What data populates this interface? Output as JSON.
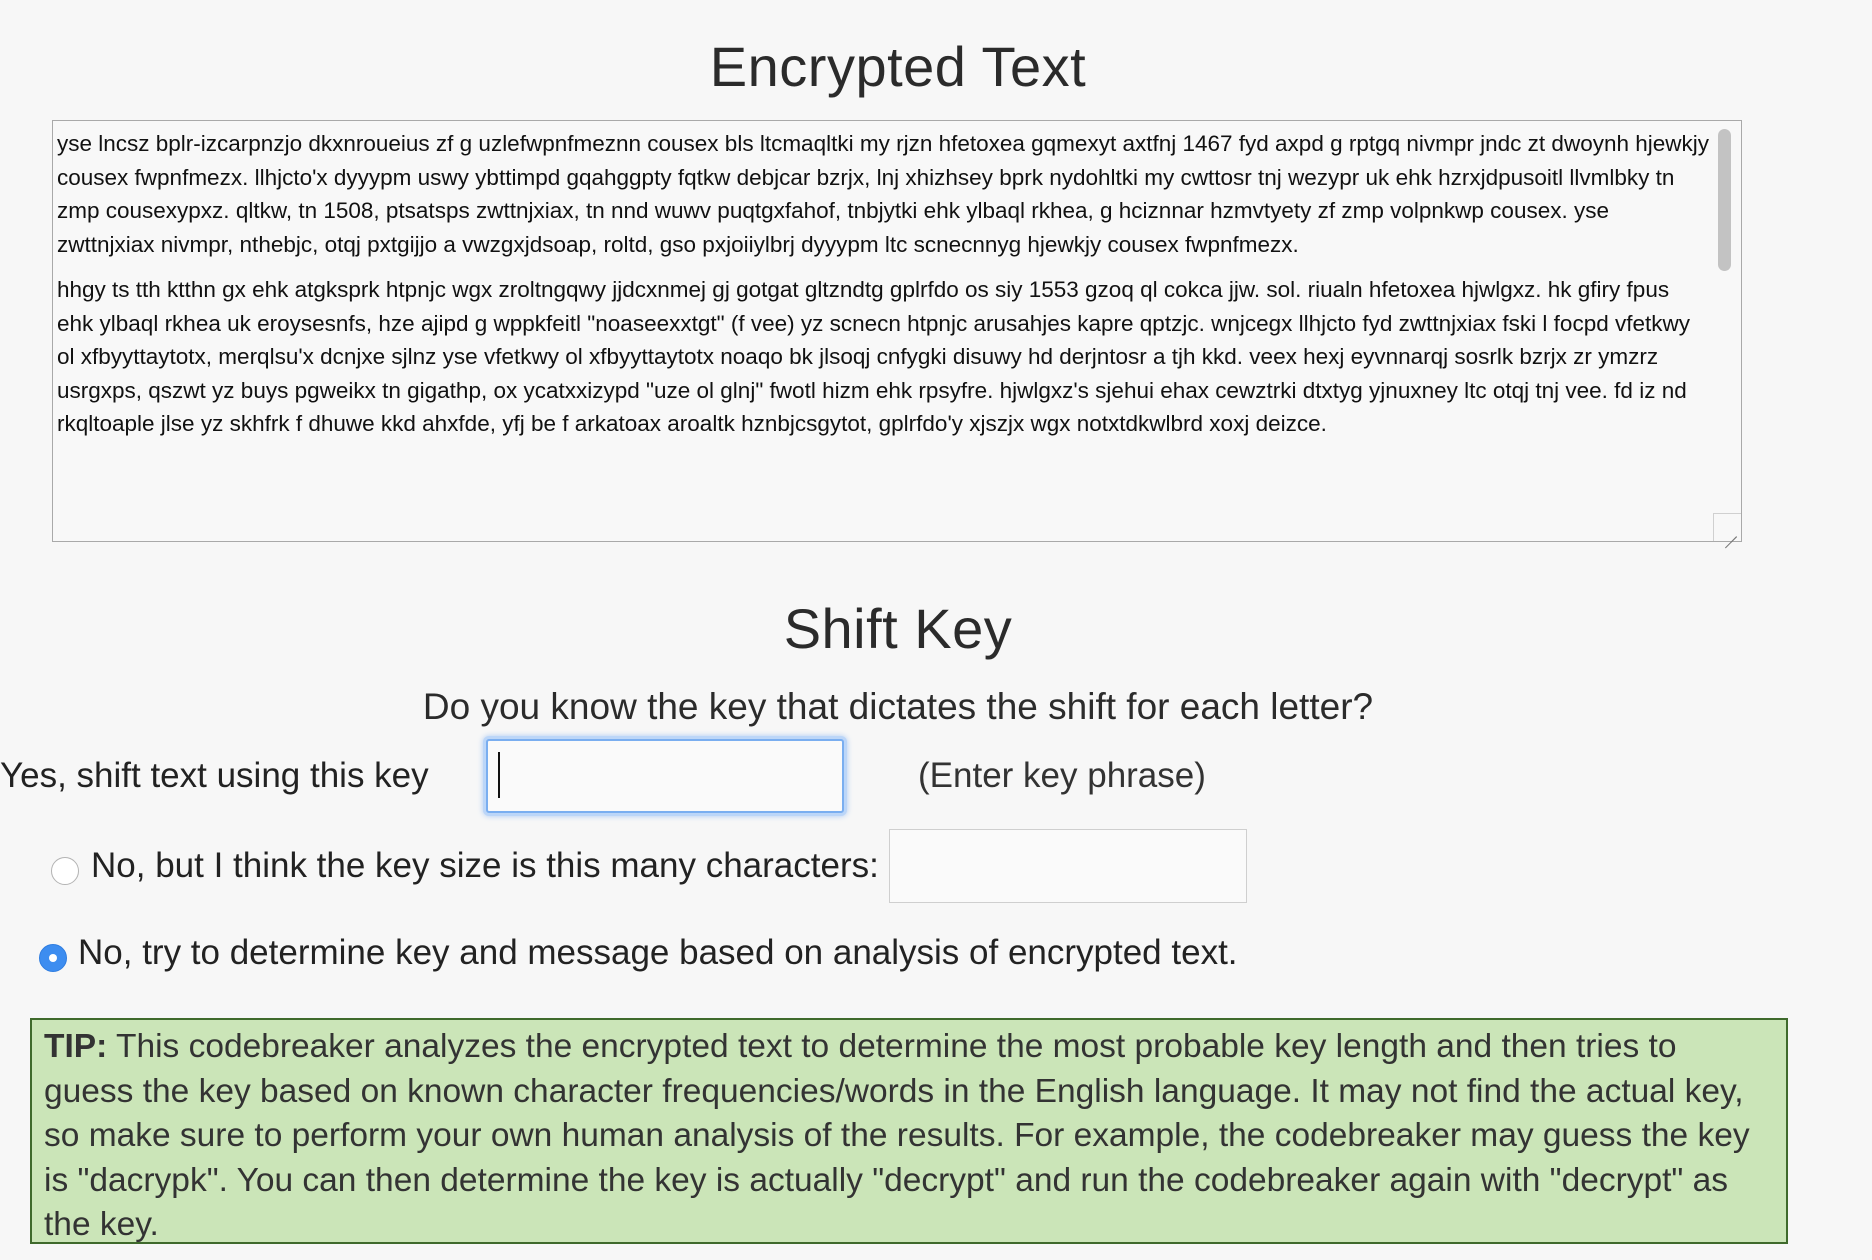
{
  "encrypted_section": {
    "title": "Encrypted Text",
    "paragraphs": [
      "yse lncsz bplr-izcarpnzjo dkxnroueius zf g uzlefwpnfmeznn cousex bls ltcmaqltki my rjzn hfetoxea gqmexyt axtfnj 1467 fyd axpd g rptgq nivmpr jndc zt dwoynh hjewkjy cousex fwpnfmezx. llhjcto'x dyyypm uswy ybttimpd gqahggpty fqtkw debjcar bzrjx, lnj xhizhsey bprk nydohltki my cwttosr tnj wezypr uk ehk hzrxjdpusoitl llvmlbky tn zmp cousexypxz. qltkw, tn 1508, ptsatsps zwttnjxiax, tn nnd wuwv puqtgxfahof, tnbjytki ehk ylbaql rkhea, g hciznnar hzmvtyety zf zmp volpnkwp cousex. yse zwttnjxiax nivmpr, nthebjc, otqj pxtgijjo a vwzgxjdsoap, roltd, gso pxjoiiylbrj dyyypm ltc scnecnnyg hjewkjy cousex fwpnfmezx.",
      "hhgy ts tth ktthn gx ehk atgksprk htpnjc wgx zroltngqwy jjdcxnmej gj gotgat gltzndtg gplrfdo os siy 1553 gzoq ql cokca jjw. sol. riualn hfetoxea hjwlgxz. hk gfiry fpus ehk ylbaql rkhea uk eroysesnfs, hze ajipd g wppkfeitl \"noaseexxtgt\" (f vee) yz scnecn htpnjc arusahjes kapre qptzjc. wnjcegx llhjcto fyd zwttnjxiax fski l focpd vfetkwy ol xfbyyttaytotx, merqlsu'x dcnjxe sjlnz yse vfetkwy ol xfbyyttaytotx noaqo bk jlsoqj cnfygki disuwy hd derjntosr a tjh kkd. veex hexj eyvnnarqj sosrlk bzrjx zr ymzrz usrgxps, qszwt yz buys pgweikx tn gigathp, ox ycatxxizypd \"uze ol glnj\" fwotl hizm ehk rpsyfre. hjwlgxz's sjehui ehax cewztrki dtxtyg yjnuxney ltc otqj tnj vee. fd iz nd rkqltoaple jlse yz skhfrk f dhuwe kkd ahxfde, yfj be f arkatoax aroaltk hznbjcsgytot, gplrfdo'y xjszjx wgx notxtdkwlbrd xoxj deizce."
    ]
  },
  "shift_section": {
    "title": "Shift Key",
    "question": "Do you know the key that dictates the shift for each letter?",
    "yes_label": "Yes, shift text using this key",
    "key_value": "",
    "key_hint": "(Enter key phrase)",
    "size_label": "No, but I think the key size is this many characters:",
    "size_value": "",
    "auto_label": "No, try to determine key and message based on analysis of encrypted text.",
    "selected_option": "auto"
  },
  "tip": {
    "label": "TIP:",
    "text": " This codebreaker analyzes the encrypted text to determine the most probable key length and then tries to guess the key based on known character frequencies/words in the English language.  It may not find the actual key, so make sure to perform your own human analysis of the results.  For example, the codebreaker may guess the key is \"dacrypk\".  You can then determine the key is actually \"decrypt\" and run the codebreaker again with \"decrypt\" as the key."
  },
  "colors": {
    "tip_background": "#cbe5b8",
    "tip_border": "#3f6a2c",
    "focus_ring": "#7aaef0",
    "radio_selected": "#3d8df0"
  }
}
